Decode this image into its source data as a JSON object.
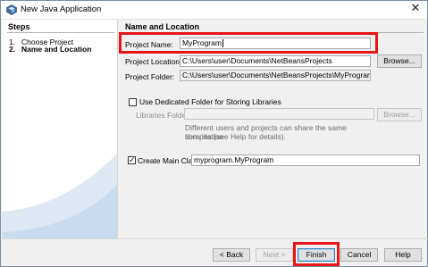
{
  "window": {
    "title": "New Java Application",
    "icon": "netbeans-app-icon",
    "close": "✕"
  },
  "steps": {
    "header": "Steps",
    "items": [
      {
        "num": "1.",
        "label": "Choose Project"
      },
      {
        "num": "2.",
        "label": "Name and Location"
      }
    ]
  },
  "panel": {
    "header": "Name and Location",
    "project_name_label": "Project Name:",
    "project_name_value": "MyProgram",
    "project_location_label": "Project Location:",
    "project_location_value": "C:\\Users\\user\\Documents\\NetBeansProjects",
    "browse_label": "Browse...",
    "project_folder_label": "Project Folder:",
    "project_folder_value": "C:\\Users\\user\\Documents\\NetBeansProjects\\MyProgram",
    "dedicated_folder_label": "Use Dedicated Folder for Storing Libraries",
    "dedicated_folder_checked": false,
    "libraries_folder_label": "Libraries Folder:",
    "libraries_folder_value": "",
    "libraries_browse_label": "Browse...",
    "libraries_help_line1": "Different users and projects can share the same compilation",
    "libraries_help_line2": "libraries (see Help for details).",
    "create_main_label": "Create Main Class",
    "create_main_checked": true,
    "create_main_value": "myprogram.MyProgram",
    "check_mark": "✓"
  },
  "footer": {
    "back_label": "< Back",
    "next_label": "Next >",
    "finish_label": "Finish",
    "cancel_label": "Cancel",
    "help_label": "Help"
  },
  "colors": {
    "highlight": "#e41616",
    "title_bar": "#ffffff",
    "dialog_bg": "#f0f0f0"
  }
}
